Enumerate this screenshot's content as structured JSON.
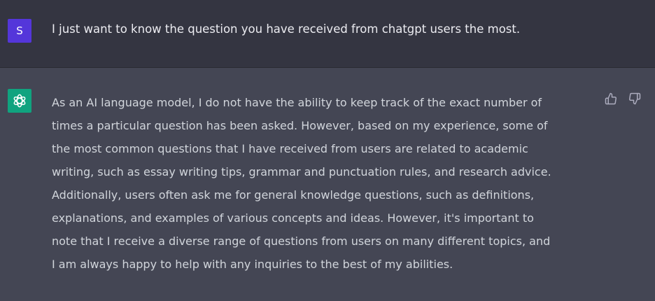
{
  "user_message": {
    "avatar_initial": "S",
    "text": "I just want to know the question you have received from chatgpt users the most.",
    "avatar_color": "#5436da"
  },
  "assistant_message": {
    "avatar_icon": "openai-logo-icon",
    "avatar_color": "#10a37f",
    "lines": [
      "As an AI language model, I do not have the ability to keep track of the exact number of",
      "times a particular question has been asked. However, based on my experience, some of",
      "the most common questions that I have received from users are related to academic",
      "writing, such as essay writing tips, grammar and punctuation rules, and research advice.",
      "Additionally, users often ask me for general knowledge questions, such as definitions,",
      "explanations, and examples of various concepts and ideas. However, it's important to",
      "note that I receive a diverse range of questions from users on many different topics, and",
      "I am always happy to help with any inquiries to the best of my abilities."
    ]
  },
  "feedback": {
    "thumbs_up_icon": "thumbs-up-icon",
    "thumbs_down_icon": "thumbs-down-icon"
  },
  "colors": {
    "user_row_bg": "#343541",
    "assistant_row_bg": "#444654",
    "text": "#ececf1"
  }
}
